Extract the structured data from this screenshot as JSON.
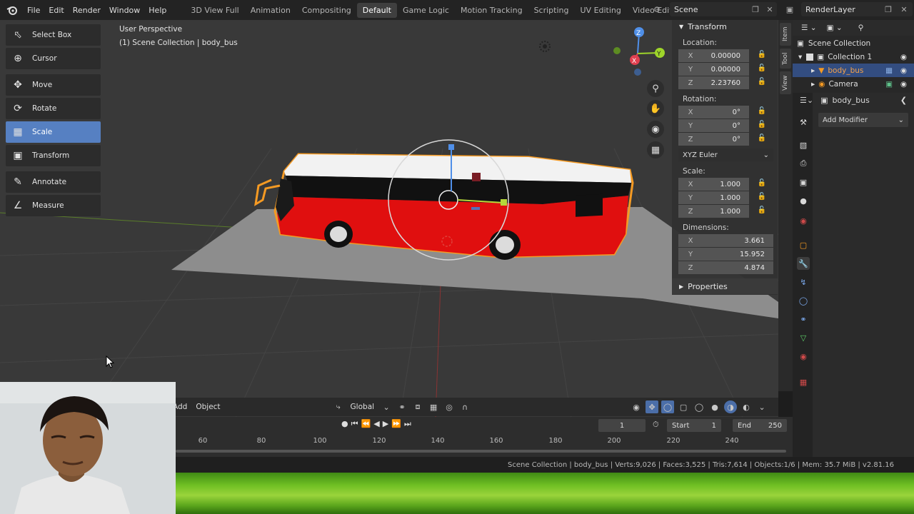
{
  "menu": {
    "items": [
      "File",
      "Edit",
      "Render",
      "Window",
      "Help"
    ]
  },
  "workspaces": {
    "tabs": [
      "3D View Full",
      "Animation",
      "Compositing",
      "Default",
      "Game Logic",
      "Motion Tracking",
      "Scripting",
      "UV Editing",
      "Video Editing"
    ],
    "active": "Default",
    "add": "+"
  },
  "scene": {
    "name": "Scene"
  },
  "view_layer": {
    "name": "RenderLayer"
  },
  "viewport": {
    "perspective": "User Perspective",
    "collection_info": "(1) Scene Collection | body_bus"
  },
  "toolbar": {
    "tools": [
      {
        "label": "Select Box",
        "icon": "select-box-icon"
      },
      {
        "label": "Cursor",
        "icon": "cursor-icon"
      },
      {
        "label": "Move",
        "icon": "move-icon"
      },
      {
        "label": "Rotate",
        "icon": "rotate-icon"
      },
      {
        "label": "Scale",
        "icon": "scale-icon"
      },
      {
        "label": "Transform",
        "icon": "transform-icon"
      },
      {
        "label": "Annotate",
        "icon": "annotate-icon"
      },
      {
        "label": "Measure",
        "icon": "measure-icon"
      }
    ],
    "active": "Scale"
  },
  "transform_panel": {
    "title": "Transform",
    "location_label": "Location:",
    "location": {
      "x": "0.00000",
      "y": "0.00000",
      "z": "2.23760"
    },
    "rotation_label": "Rotation:",
    "rotation": {
      "x": "0°",
      "y": "0°",
      "z": "0°"
    },
    "rotation_mode": "XYZ Euler",
    "scale_label": "Scale:",
    "scale": {
      "x": "1.000",
      "y": "1.000",
      "z": "1.000"
    },
    "dimensions_label": "Dimensions:",
    "dimensions": {
      "x": "3.661",
      "y": "15.952",
      "z": "4.874"
    },
    "axis_x": "X",
    "axis_y": "Y",
    "axis_z": "Z",
    "properties_label": "Properties"
  },
  "side_tabs": [
    "Item",
    "Tool",
    "View"
  ],
  "outliner": {
    "root": "Scene Collection",
    "collection": "Collection 1",
    "items": [
      "body_bus",
      "Camera"
    ]
  },
  "properties": {
    "object_name": "body_bus",
    "add_modifier": "Add Modifier"
  },
  "viewport_header": {
    "add": "Add",
    "object": "Object",
    "orientation": "Global"
  },
  "timeline": {
    "current_frame": "1",
    "start_label": "Start",
    "start": "1",
    "end_label": "End",
    "end": "250",
    "ticks": [
      "60",
      "80",
      "100",
      "120",
      "140",
      "160",
      "180",
      "200",
      "220",
      "240"
    ]
  },
  "status": {
    "text": "Scene Collection | body_bus | Verts:9,026 | Faces:3,525 | Tris:7,614 | Objects:1/6 | Mem: 35.7 MiB | v2.81.16"
  },
  "colors": {
    "accent": "#5680c2",
    "bus_body": "#e00f0f",
    "bus_roof": "#f2f2f2",
    "selection_outline": "#f59a23"
  }
}
